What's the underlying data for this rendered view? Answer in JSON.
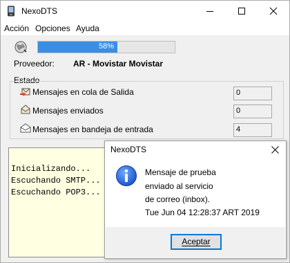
{
  "window": {
    "title": "NexoDTS",
    "icon": "phone-icon"
  },
  "menu": [
    "Acción",
    "Opciones",
    "Ayuda"
  ],
  "status": {
    "progress_text": "58%",
    "progress": 0.58,
    "progress_color": "#3a8ee6"
  },
  "provider": {
    "label": "Proveedor:",
    "value": "AR - Movistar Movistar"
  },
  "estado": {
    "title": "Estado",
    "rows": [
      {
        "label": "Mensajes en cola de Salida",
        "value": "0",
        "icon": "outbox-icon"
      },
      {
        "label": "Mensajes enviados",
        "value": "0",
        "icon": "sent-mail-icon"
      },
      {
        "label": "Mensajes en bandeja de entrada",
        "value": "4",
        "icon": "inbox-mail-icon"
      }
    ]
  },
  "log": [
    "Inicializando...",
    "Escuchando SMTP...",
    "Escuchando POP3..."
  ],
  "log_bg": "#ffffe1",
  "dialog": {
    "title": "NexoDTS",
    "lines": [
      "Mensaje de prueba",
      "enviado al servicio",
      "de correo (inbox).",
      "Tue Jun 04 12:28:37 ART 2019"
    ],
    "ok": "Aceptar",
    "icon": "info-icon"
  }
}
